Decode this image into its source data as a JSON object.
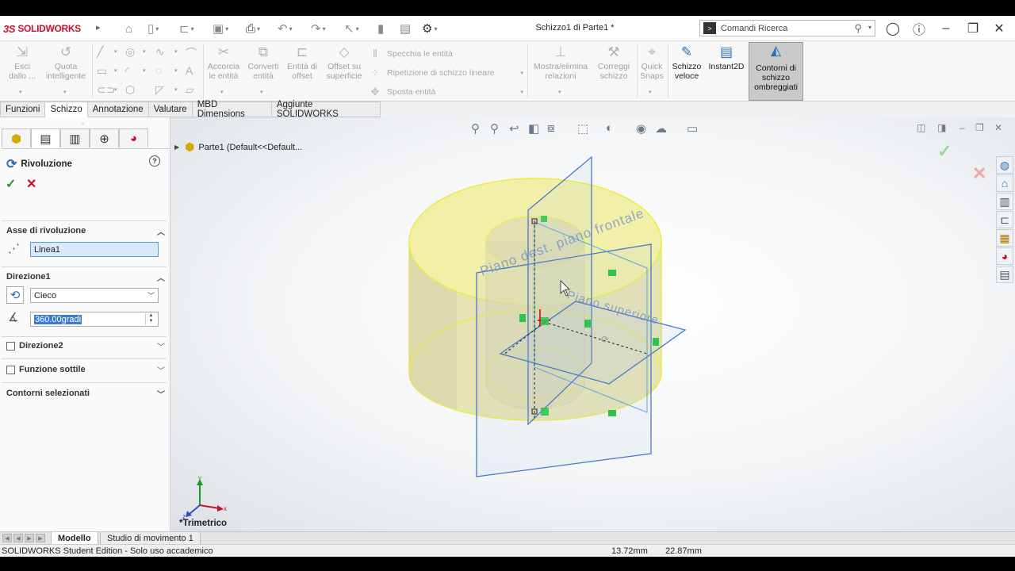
{
  "app": {
    "logo_text": "SOLIDWORKS",
    "document_title": "Schizzo1 di Parte1 *"
  },
  "search": {
    "placeholder": "Comandi Ricerca"
  },
  "ribbon": {
    "esci": "Esci\ndallo ...",
    "quota": "Quota\nintelligente",
    "accorcia": "Accorcia\nle entità",
    "converti": "Converti\nentità",
    "entita_offset": "Entità di\noffset",
    "offset_superficie": "Offset su\nsuperficie",
    "specchia": "Specchia le entità",
    "ripetizione": "Ripetizione di schizzo lineare",
    "sposta": "Sposta entità",
    "mostra_elimina": "Mostra/elimina\nrelazioni",
    "correggi": "Correggi\nschizzo",
    "quick_snaps": "Quick\nSnaps",
    "schizzo_veloce": "Schizzo\nveloce",
    "instant2d": "Instant2D",
    "contorni": "Contorni di\nschizzo\nombreggiati"
  },
  "tabs": [
    "Funzioni",
    "Schizzo",
    "Annotazione",
    "Valutare",
    "MBD Dimensions",
    "Aggiunte SOLIDWORKS"
  ],
  "property_manager": {
    "title": "Rivoluzione",
    "asse_header": "Asse di rivoluzione",
    "asse_value": "Linea1",
    "direzione1_header": "Direzione1",
    "direzione1_type": "Cieco",
    "angle_value": "360.00gradi",
    "direzione2_label": "Direzione2",
    "funzione_sottile_label": "Funzione sottile",
    "contorni_selezionati_header": "Contorni selezionati"
  },
  "viewport": {
    "tree_root": "Parte1  (Default<<Default...",
    "view_name": "*Trimetrico",
    "plane_front": "Piano dest. piano frontale",
    "plane_top": "Piano superiore",
    "axis_x": "x",
    "axis_y": "y",
    "axis_z": "z"
  },
  "bottom_tabs": [
    "Modello",
    "Studio di movimento 1"
  ],
  "status": {
    "edition": "SOLIDWORKS Student Edition - Solo uso accademico",
    "coord_x": "13.72mm",
    "coord_y": "22.87mm"
  },
  "colors": {
    "brand": "#c8102e",
    "accent": "#2a6fb0",
    "ok": "#1a9a2a",
    "model_fill": "#f2f0a8",
    "plane_stroke": "#4a78c8"
  }
}
